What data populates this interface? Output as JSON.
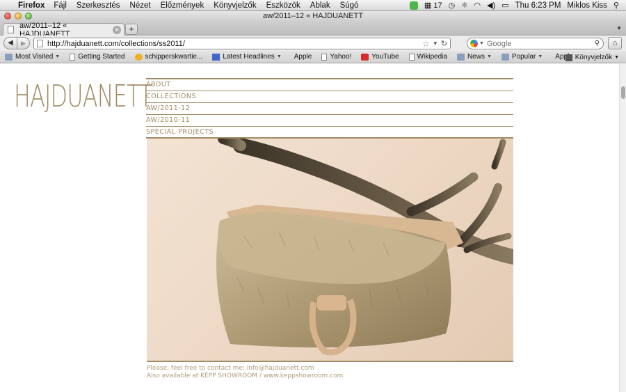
{
  "menubar": {
    "app": "Firefox",
    "items": [
      "Fájl",
      "Szerkesztés",
      "Nézet",
      "Előzmények",
      "Könyvjelzők",
      "Eszközök",
      "Ablak",
      "Súgó"
    ],
    "status": {
      "calendar_badge": "17",
      "clock": "Thu 6:23 PM",
      "user": "Miklos Kiss"
    }
  },
  "window": {
    "title": "aw/2011–12 « HAJDUANETT"
  },
  "tabs": [
    {
      "title": "aw/2011–12 « HAJDUANETT"
    }
  ],
  "toolbar": {
    "url": "http://hajduanett.com/collections/ss2011/",
    "search_placeholder": "Google"
  },
  "bookmarks": {
    "items": [
      "Most Visited",
      "Getting Started",
      "schipperskwartie...",
      "Latest Headlines",
      "Apple",
      "Yahoo!",
      "YouTube",
      "Wikipedia",
      "News",
      "Popular",
      "Apple"
    ],
    "more": "»",
    "folder": "Könyvjelzők"
  },
  "site": {
    "logo": "HAJDUANETT",
    "nav": [
      "ABOUT",
      "COLLECTIONS",
      "AW/2011-12",
      "AW/2010-11",
      "SPECIAL PROJECTS"
    ],
    "contact_line1": "Please, feel free to contact me: info@hajduanett.com",
    "contact_line2": "Also available at KEPP SHOWROOM / www.keppshowroom.com"
  },
  "colors": {
    "brand": "#a08c66",
    "contact": "#b09c78"
  }
}
